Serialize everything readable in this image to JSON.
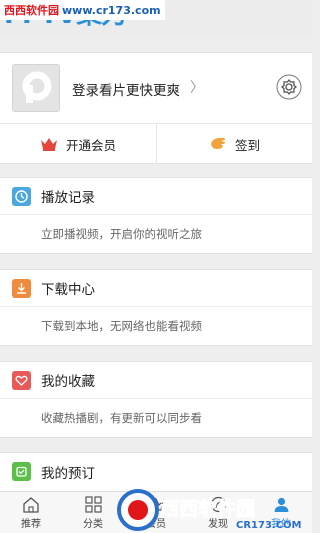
{
  "brand": {
    "logo_text": "PPTV聚力"
  },
  "watermark_top": {
    "site_name": "西西软件园",
    "url": "www.cr173.com"
  },
  "profile": {
    "login_prompt": "登录看片更快更爽",
    "arrow": "〉"
  },
  "member": {
    "vip_label": "开通会员",
    "signin_label": "签到"
  },
  "sections": [
    {
      "title": "播放记录",
      "desc": "立即播视频，开启你的视听之旅",
      "color": "#4aa8e0",
      "icon": "clock-icon"
    },
    {
      "title": "下载中心",
      "desc": "下载到本地，无网络也能看视频",
      "color": "#f08a3c",
      "icon": "download-icon"
    },
    {
      "title": "我的收藏",
      "desc": "收藏热播剧，有更新可以同步看",
      "color": "#e85a5a",
      "icon": "heart-icon"
    },
    {
      "title": "我的预订",
      "color": "#5cbf4a",
      "icon": "alarm-icon"
    }
  ],
  "tabs": [
    {
      "label": "推荐",
      "icon": "home-icon"
    },
    {
      "label": "分类",
      "icon": "grid-icon"
    },
    {
      "label": "会员",
      "icon": "vip-icon"
    },
    {
      "label": "发现",
      "icon": "discover-icon"
    },
    {
      "label": "我的",
      "icon": "user-icon",
      "active": true
    }
  ],
  "watermark_bottom": {
    "site_name": "西西软件园",
    "url": "CR173.COM"
  },
  "colors": {
    "accent": "#2a8fd8",
    "background": "#eeeeee"
  }
}
